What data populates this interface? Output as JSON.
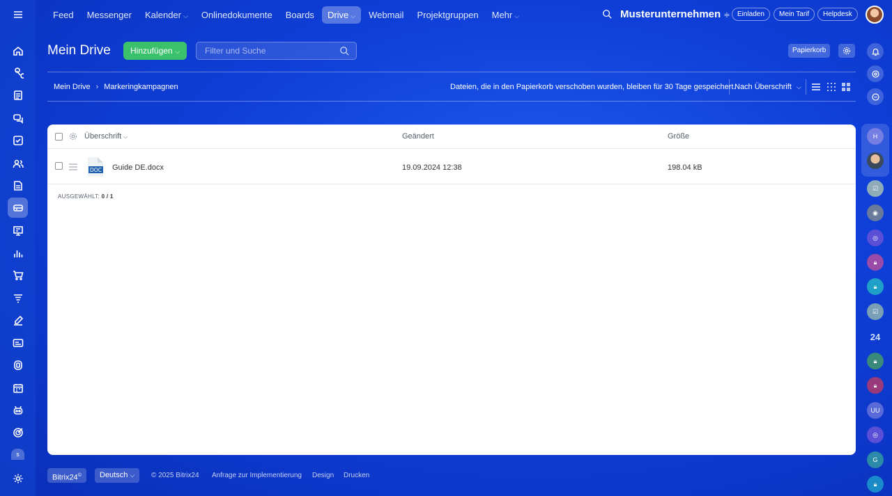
{
  "topnav": {
    "items": [
      {
        "label": "Feed"
      },
      {
        "label": "Messenger"
      },
      {
        "label": "Kalender"
      },
      {
        "label": "Onlinedokumente"
      },
      {
        "label": "Boards"
      },
      {
        "label": "Drive"
      },
      {
        "label": "Webmail"
      },
      {
        "label": "Projektgruppen"
      },
      {
        "label": "Mehr"
      }
    ],
    "active": "Drive",
    "company": "Musterunternehmen",
    "invite": "Einladen",
    "plan": "Mein Tarif",
    "helpdesk": "Helpdesk"
  },
  "sidebar": {
    "icons": [
      "menu-icon",
      "home-icon",
      "workflow-icon",
      "document-icon",
      "chat-icon",
      "tasks-icon",
      "contacts-icon",
      "pages-icon",
      "drive-icon",
      "presentation-icon",
      "analytics-icon",
      "shop-icon",
      "funnel-icon",
      "edit-icon",
      "card-icon",
      "shield-icon",
      "calendar-icon",
      "robot-icon",
      "target-icon"
    ],
    "active": "drive-icon",
    "badge": "s"
  },
  "header": {
    "title": "Mein Drive",
    "add_label": "Hinzufügen",
    "filter_placeholder": "Filter und Suche",
    "trash_label": "Papierkorb"
  },
  "breadcrumb": {
    "root": "Mein Drive",
    "current": "Markeringkampagnen"
  },
  "toolbar": {
    "hint": "Dateien, die in den Papierkorb verschoben wurden, bleiben für 30 Tage gespeichert.",
    "sort_label": "Nach Überschrift"
  },
  "table": {
    "headers": {
      "name": "Überschrift",
      "modified": "Geändert",
      "size": "Größe"
    },
    "rows": [
      {
        "name": "Guide DE.docx",
        "modified": "19.09.2024 12:38",
        "size": "198.04 kB",
        "type": "DOC"
      }
    ],
    "selected_label": "AUSGEWÄHLT:",
    "selected_count": "0 / 1"
  },
  "rightbar": {
    "label_24": "24",
    "initials_h": "H",
    "initials_uu": "UU",
    "initials_g": "G"
  },
  "footer": {
    "brand": "Bitrix24",
    "language": "Deutsch",
    "copyright": "© 2025 Bitrix24",
    "links": [
      "Anfrage zur Implementierung",
      "Design",
      "Drucken"
    ]
  },
  "colors": {
    "accent_green": "#3bc16b",
    "background_blue": "#0f3fd8"
  }
}
